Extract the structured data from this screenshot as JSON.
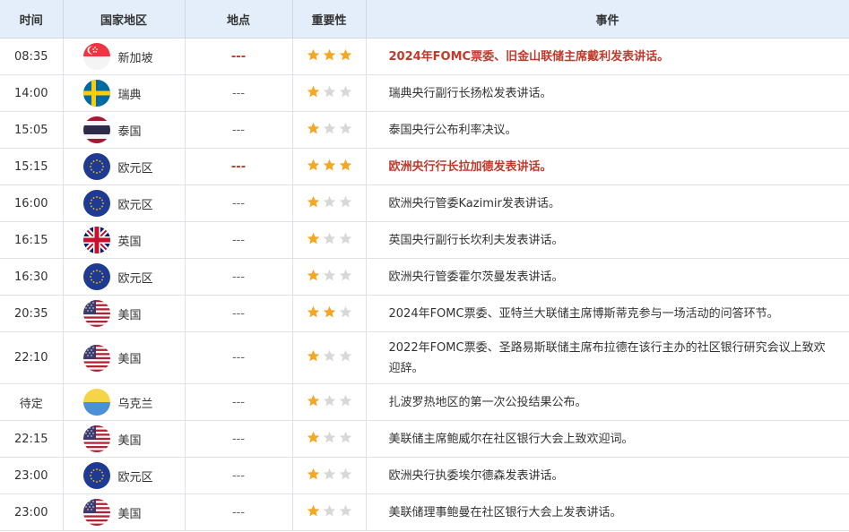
{
  "headers": {
    "time": "时间",
    "country": "国家地区",
    "place": "地点",
    "importance": "重要性",
    "event": "事件"
  },
  "colors": {
    "header_bg": "#e3eefa",
    "important_text": "#c0392b",
    "star_on": "#f5a623",
    "star_off": "#d8d8d8"
  },
  "rows": [
    {
      "time": "08:35",
      "country": "新加坡",
      "flag": "singapore-flag-icon",
      "place": "---",
      "stars": 3,
      "event": "2024年FOMC票委、旧金山联储主席戴利发表讲话。",
      "important": true
    },
    {
      "time": "14:00",
      "country": "瑞典",
      "flag": "sweden-flag-icon",
      "place": "---",
      "stars": 1,
      "event": "瑞典央行副行长扬松发表讲话。",
      "important": false
    },
    {
      "time": "15:05",
      "country": "泰国",
      "flag": "thailand-flag-icon",
      "place": "---",
      "stars": 1,
      "event": "泰国央行公布利率决议。",
      "important": false
    },
    {
      "time": "15:15",
      "country": "欧元区",
      "flag": "eu-flag-icon",
      "place": "---",
      "stars": 3,
      "event": "欧洲央行行长拉加德发表讲话。",
      "important": true
    },
    {
      "time": "16:00",
      "country": "欧元区",
      "flag": "eu-flag-icon",
      "place": "---",
      "stars": 1,
      "event": "欧洲央行管委Kazimir发表讲话。",
      "important": false
    },
    {
      "time": "16:15",
      "country": "英国",
      "flag": "uk-flag-icon",
      "place": "---",
      "stars": 1,
      "event": "英国央行副行长坎利夫发表讲话。",
      "important": false
    },
    {
      "time": "16:30",
      "country": "欧元区",
      "flag": "eu-flag-icon",
      "place": "---",
      "stars": 1,
      "event": "欧洲央行管委霍尔茨曼发表讲话。",
      "important": false
    },
    {
      "time": "20:35",
      "country": "美国",
      "flag": "us-flag-icon",
      "place": "---",
      "stars": 2,
      "event": "2024年FOMC票委、亚特兰大联储主席博斯蒂克参与一场活动的问答环节。",
      "important": false
    },
    {
      "time": "22:10",
      "country": "美国",
      "flag": "us-flag-icon",
      "place": "---",
      "stars": 1,
      "event": "2022年FOMC票委、圣路易斯联储主席布拉德在该行主办的社区银行研究会议上致欢迎辞。",
      "important": false,
      "tall": true
    },
    {
      "time": "待定",
      "country": "乌克兰",
      "flag": "ukraine-flag-icon",
      "place": "---",
      "stars": 1,
      "event": "扎波罗热地区的第一次公投结果公布。",
      "important": false
    },
    {
      "time": "22:15",
      "country": "美国",
      "flag": "us-flag-icon",
      "place": "---",
      "stars": 1,
      "event": "美联储主席鲍威尔在社区银行大会上致欢迎词。",
      "important": false
    },
    {
      "time": "23:00",
      "country": "欧元区",
      "flag": "eu-flag-icon",
      "place": "---",
      "stars": 1,
      "event": "欧洲央行执委埃尔德森发表讲话。",
      "important": false
    },
    {
      "time": "23:00",
      "country": "美国",
      "flag": "us-flag-icon",
      "place": "---",
      "stars": 1,
      "event": "美联储理事鲍曼在社区银行大会上发表讲话。",
      "important": false
    }
  ]
}
